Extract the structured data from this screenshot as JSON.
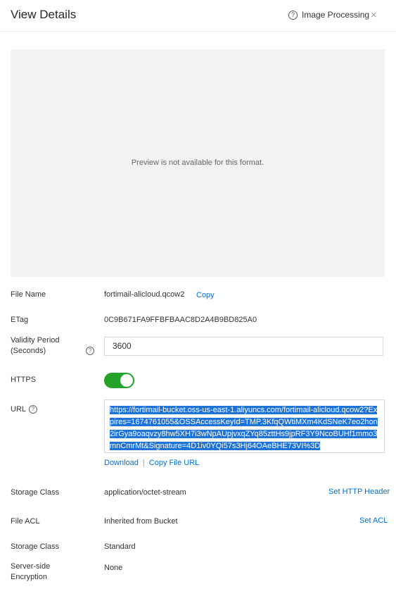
{
  "header": {
    "title": "View Details",
    "image_processing": "Image Processing",
    "close": "×"
  },
  "preview": {
    "message": "Preview is not available for this format."
  },
  "file_name": {
    "label": "File Name",
    "value": "fortimail-alicloud.qcow2",
    "copy_label": "Copy"
  },
  "etag": {
    "label": "ETag",
    "value": "0C9B671FA9FFBFBAAC8D2A4B9BD825A0"
  },
  "validity": {
    "label_line1": "Validity Period",
    "label_line2": "(Seconds)",
    "value": "3600"
  },
  "https": {
    "label": "HTTPS",
    "enabled": true
  },
  "url": {
    "label": "URL",
    "line1": "https://fortimail-bucket.oss-us-east-1.aliyuncs.com/fortimail-alicloud.qcow2?Exp",
    "line2": "ires=1674761055&OSSAccessKeyId=TMP.3KfqQWtiMXm4KdSNeK7eo2hon2irGy",
    "line3": "a9oaqvzy8hw5XH7i3wNpAUpjvxqZYq85zttHs9jpRF3Y9NcoBUHf1mmo3mnCmr",
    "line4": "Mt&Signature=4D1iv0YQi57s3Hj64OAeBHE73VI%3D",
    "download_label": "Download",
    "separator": "|",
    "copy_url_label": "Copy File URL"
  },
  "storage_class_type": {
    "label": "Storage Class",
    "value": "application/octet-stream",
    "action": "Set HTTP Header"
  },
  "file_acl": {
    "label": "File ACL",
    "value": "Inherited from Bucket",
    "action": "Set ACL"
  },
  "storage_class": {
    "label": "Storage Class",
    "value": "Standard"
  },
  "encryption": {
    "label_line1": "Server-side",
    "label_line2": "Encryption",
    "value": "None"
  },
  "colors": {
    "accent": "#0070cc",
    "toggle_on": "#23a328",
    "selection": "#1e73d9"
  }
}
